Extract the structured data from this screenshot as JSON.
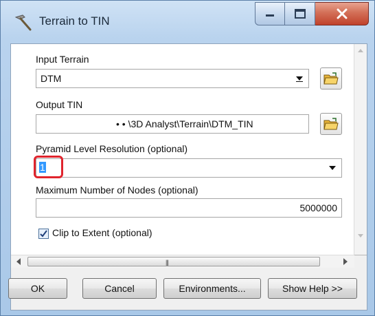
{
  "window": {
    "title": "Terrain to TIN",
    "icon": "hammer-tool-icon"
  },
  "form": {
    "input_terrain": {
      "label": "Input Terrain",
      "value": "DTM"
    },
    "output_tin": {
      "label": "Output TIN",
      "value": "• • \\3D Analyst\\Terrain\\DTM_TIN"
    },
    "pyramid": {
      "label": "Pyramid Level Resolution (optional)",
      "value": "1"
    },
    "max_nodes": {
      "label": "Maximum Number of Nodes (optional)",
      "value": "5000000"
    },
    "clip": {
      "label": "Clip to Extent (optional)",
      "checked": true
    }
  },
  "buttons": {
    "ok": "OK",
    "cancel": "Cancel",
    "environments": "Environments...",
    "show_help": "Show Help >>"
  },
  "colors": {
    "highlight": "#e0242d",
    "close_button": "#c0422b",
    "selection": "#3399ff"
  }
}
